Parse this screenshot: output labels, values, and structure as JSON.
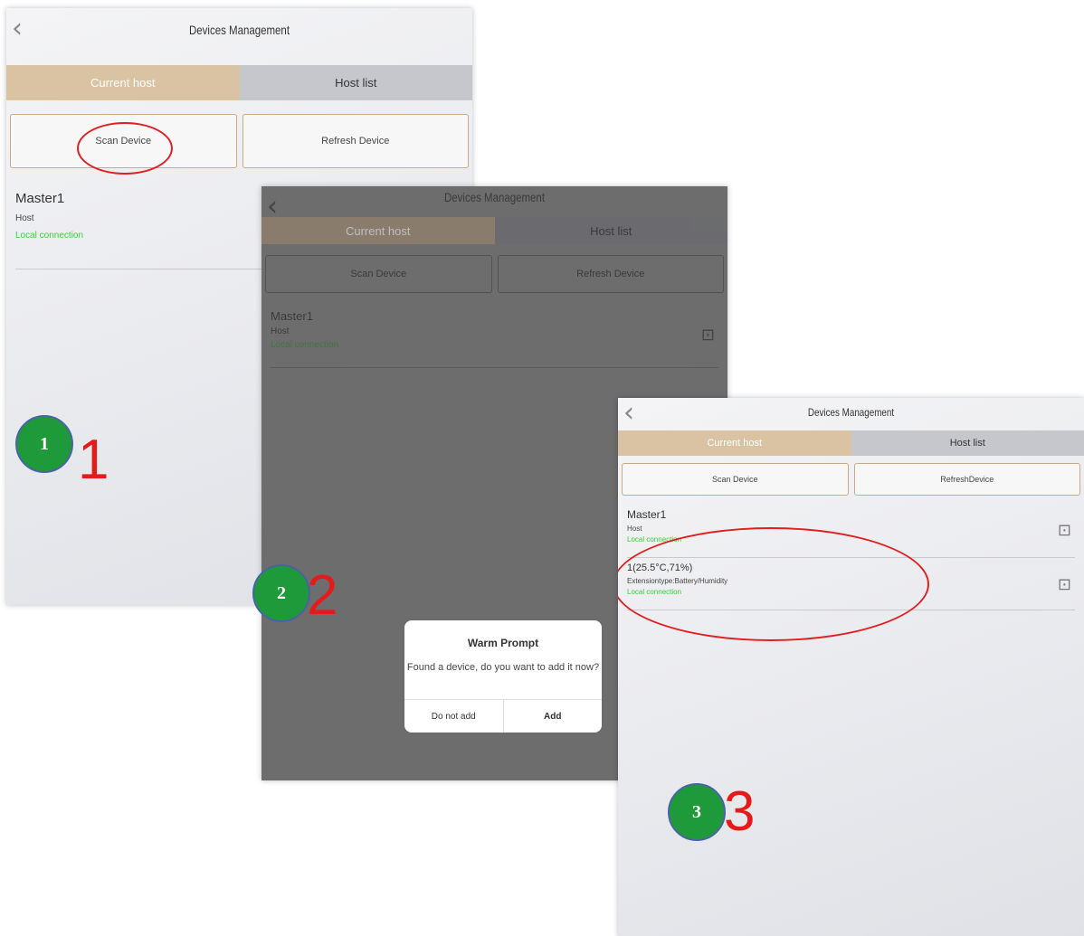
{
  "screen1": {
    "title": "Devices Management",
    "tabs": [
      "Current host",
      "Host list"
    ],
    "buttons": [
      "Scan Device",
      "Refresh Device"
    ],
    "device": {
      "name": "Master1",
      "type": "Host",
      "connection": "Local connection"
    },
    "step_number": "1",
    "step_digit": "1"
  },
  "screen2": {
    "title": "Devices Management",
    "tabs": [
      "Current host",
      "Host list"
    ],
    "buttons": [
      "Scan Device",
      "Refresh Device"
    ],
    "device": {
      "name": "Master1",
      "type": "Host",
      "connection": "Local connection"
    },
    "dialog": {
      "title": "Warm Prompt",
      "message": "Found a device, do you want to add it now?",
      "cancel_label": "Do not add",
      "confirm_label": "Add"
    },
    "step_number": "2",
    "step_digit": "2"
  },
  "screen3": {
    "title": "Devices Management",
    "tabs": [
      "Current host",
      "Host list"
    ],
    "buttons": [
      "Scan Device",
      "RefreshDevice"
    ],
    "devices": [
      {
        "name": "Master1",
        "type": "Host",
        "connection": "Local connection"
      },
      {
        "name": "1(25.5°C,71%)",
        "type": "Extensiontype:Battery/Humidity",
        "connection": "Local connection"
      }
    ],
    "step_number": "3",
    "step_digit": "3"
  },
  "colors": {
    "accent_tab": "#d9c3a3",
    "annotation_red": "#e02020",
    "step_green": "#1f9a3a",
    "connection_green": "#37d137"
  }
}
